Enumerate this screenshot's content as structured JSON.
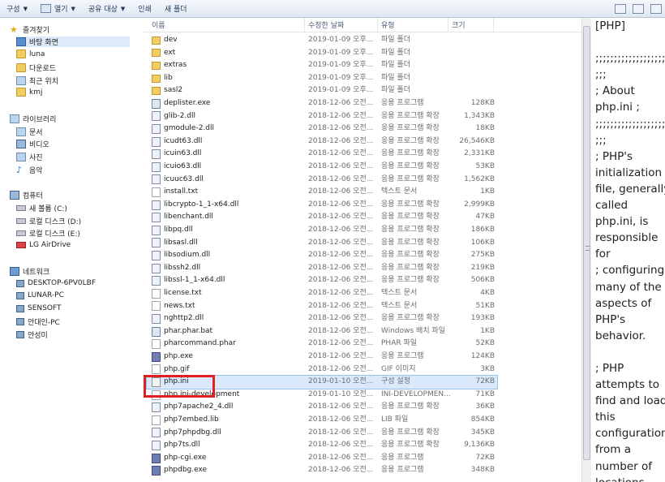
{
  "toolbar": {
    "organize": "구성",
    "open": "열기",
    "share": "공유 대상",
    "print": "인쇄",
    "new_folder": "새 폴더"
  },
  "nav": {
    "favorites": "즐겨찾기",
    "desktop": "바탕 화면",
    "luna": "luna",
    "downloads": "다운로드",
    "recent": "최근 위치",
    "kmj": "kmj",
    "libraries": "라이브러리",
    "docs": "문서",
    "video": "비디오",
    "pictures": "사진",
    "music": "음악",
    "computer": "컴퓨터",
    "vol_c": "새 볼륨 (C:)",
    "disk_d": "로컬 디스크 (D:)",
    "disk_e": "로컬 디스크 (E:)",
    "airdrive": "LG AirDrive",
    "network": "네트워크",
    "net1": "DESKTOP-6PV0LBF",
    "net2": "LUNAR-PC",
    "net3": "SENSOFT",
    "net4": "안대인-PC",
    "net5": "안성미"
  },
  "columns": {
    "name": "이름",
    "date": "수정한 날짜",
    "type": "유형",
    "size": "크기"
  },
  "files": [
    {
      "name": "dev",
      "date": "2019-01-09 오후...",
      "type": "파일 폴더",
      "size": "",
      "icon": "folder"
    },
    {
      "name": "ext",
      "date": "2019-01-09 오후...",
      "type": "파일 폴더",
      "size": "",
      "icon": "folder"
    },
    {
      "name": "extras",
      "date": "2019-01-09 오후...",
      "type": "파일 폴더",
      "size": "",
      "icon": "folder"
    },
    {
      "name": "lib",
      "date": "2019-01-09 오후...",
      "type": "파일 폴더",
      "size": "",
      "icon": "folder"
    },
    {
      "name": "sasl2",
      "date": "2019-01-09 오후...",
      "type": "파일 폴더",
      "size": "",
      "icon": "folder"
    },
    {
      "name": "deplister.exe",
      "date": "2018-12-06 오전...",
      "type": "응용 프로그램",
      "size": "128KB",
      "icon": "exe"
    },
    {
      "name": "glib-2.dll",
      "date": "2018-12-06 오전...",
      "type": "응용 프로그램 확장",
      "size": "1,343KB",
      "icon": "dll"
    },
    {
      "name": "gmodule-2.dll",
      "date": "2018-12-06 오전...",
      "type": "응용 프로그램 확장",
      "size": "18KB",
      "icon": "dll"
    },
    {
      "name": "icudt63.dll",
      "date": "2018-12-06 오전...",
      "type": "응용 프로그램 확장",
      "size": "26,546KB",
      "icon": "dll"
    },
    {
      "name": "icuin63.dll",
      "date": "2018-12-06 오전...",
      "type": "응용 프로그램 확장",
      "size": "2,331KB",
      "icon": "dll"
    },
    {
      "name": "icuio63.dll",
      "date": "2018-12-06 오전...",
      "type": "응용 프로그램 확장",
      "size": "53KB",
      "icon": "dll"
    },
    {
      "name": "icuuc63.dll",
      "date": "2018-12-06 오전...",
      "type": "응용 프로그램 확장",
      "size": "1,562KB",
      "icon": "dll"
    },
    {
      "name": "install.txt",
      "date": "2018-12-06 오전...",
      "type": "텍스트 문서",
      "size": "1KB",
      "icon": "file"
    },
    {
      "name": "libcrypto-1_1-x64.dll",
      "date": "2018-12-06 오전...",
      "type": "응용 프로그램 확장",
      "size": "2,999KB",
      "icon": "dll"
    },
    {
      "name": "libenchant.dll",
      "date": "2018-12-06 오전...",
      "type": "응용 프로그램 확장",
      "size": "47KB",
      "icon": "dll"
    },
    {
      "name": "libpq.dll",
      "date": "2018-12-06 오전...",
      "type": "응용 프로그램 확장",
      "size": "186KB",
      "icon": "dll"
    },
    {
      "name": "libsasl.dll",
      "date": "2018-12-06 오전...",
      "type": "응용 프로그램 확장",
      "size": "106KB",
      "icon": "dll"
    },
    {
      "name": "libsodium.dll",
      "date": "2018-12-06 오전...",
      "type": "응용 프로그램 확장",
      "size": "275KB",
      "icon": "dll"
    },
    {
      "name": "libssh2.dll",
      "date": "2018-12-06 오전...",
      "type": "응용 프로그램 확장",
      "size": "219KB",
      "icon": "dll"
    },
    {
      "name": "libssl-1_1-x64.dll",
      "date": "2018-12-06 오전...",
      "type": "응용 프로그램 확장",
      "size": "506KB",
      "icon": "dll"
    },
    {
      "name": "license.txt",
      "date": "2018-12-06 오전...",
      "type": "텍스트 문서",
      "size": "4KB",
      "icon": "file"
    },
    {
      "name": "news.txt",
      "date": "2018-12-06 오전...",
      "type": "텍스트 문서",
      "size": "51KB",
      "icon": "file"
    },
    {
      "name": "nghttp2.dll",
      "date": "2018-12-06 오전...",
      "type": "응용 프로그램 확장",
      "size": "193KB",
      "icon": "dll"
    },
    {
      "name": "phar.phar.bat",
      "date": "2018-12-06 오전...",
      "type": "Windows 배치 파일",
      "size": "1KB",
      "icon": "exe"
    },
    {
      "name": "pharcommand.phar",
      "date": "2018-12-06 오전...",
      "type": "PHAR 파일",
      "size": "52KB",
      "icon": "file"
    },
    {
      "name": "php.exe",
      "date": "2018-12-06 오전...",
      "type": "응용 프로그램",
      "size": "124KB",
      "icon": "php"
    },
    {
      "name": "php.gif",
      "date": "2018-12-06 오전...",
      "type": "GIF 이미지",
      "size": "3KB",
      "icon": "file"
    },
    {
      "name": "php.ini",
      "date": "2019-01-10 오전...",
      "type": "구성 설정",
      "size": "72KB",
      "icon": "ini"
    },
    {
      "name": "php.ini-development",
      "date": "2019-01-10 오전...",
      "type": "INI-DEVELOPMEN...",
      "size": "71KB",
      "icon": "file"
    },
    {
      "name": "php7apache2_4.dll",
      "date": "2018-12-06 오전...",
      "type": "응용 프로그램 확장",
      "size": "36KB",
      "icon": "dll"
    },
    {
      "name": "php7embed.lib",
      "date": "2018-12-06 오전...",
      "type": "LIB 파일",
      "size": "854KB",
      "icon": "file"
    },
    {
      "name": "php7phpdbg.dll",
      "date": "2018-12-06 오전...",
      "type": "응용 프로그램 확장",
      "size": "345KB",
      "icon": "dll"
    },
    {
      "name": "php7ts.dll",
      "date": "2018-12-06 오전...",
      "type": "응용 프로그램 확장",
      "size": "9,136KB",
      "icon": "dll"
    },
    {
      "name": "php-cgi.exe",
      "date": "2018-12-06 오전...",
      "type": "응용 프로그램",
      "size": "72KB",
      "icon": "php"
    },
    {
      "name": "phpdbg.exe",
      "date": "2018-12-06 오전...",
      "type": "응용 프로그램",
      "size": "348KB",
      "icon": "php"
    }
  ],
  "preview": {
    "lines": [
      "[PHP]",
      "",
      ";;;;;;;;;;;;;;;;;;;",
      ";;;",
      "; About",
      "php.ini   ;",
      ";;;;;;;;;;;;;;;;;;;",
      ";;;",
      "; PHP's",
      "initialization",
      "file, generally",
      "called",
      "php.ini, is",
      "responsible",
      "for",
      "; configuring",
      "many of the",
      "aspects of",
      "PHP's",
      "behavior.",
      "",
      "; PHP",
      "attempts to",
      "find and load",
      "this",
      "configuration",
      "from a",
      "number of",
      "locations"
    ]
  }
}
